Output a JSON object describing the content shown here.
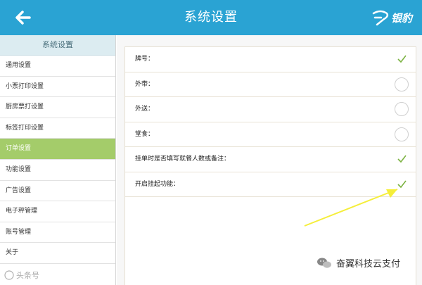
{
  "header": {
    "title": "系统设置",
    "brand": "银豹",
    "color": "#2aa3d3"
  },
  "sidebar": {
    "title": "系统设置",
    "items": [
      {
        "label": "通用设置",
        "active": false
      },
      {
        "label": "小票打印设置",
        "active": false
      },
      {
        "label": "厨房票打设置",
        "active": false
      },
      {
        "label": "标签打印设置",
        "active": false
      },
      {
        "label": "订单设置",
        "active": true
      },
      {
        "label": "功能设置",
        "active": false
      },
      {
        "label": "广告设置",
        "active": false
      },
      {
        "label": "电子秤管理",
        "active": false
      },
      {
        "label": "账号管理",
        "active": false
      },
      {
        "label": "关于",
        "active": false
      }
    ],
    "active_color": "#a4cc6a"
  },
  "settings": [
    {
      "label": "牌号：",
      "checked": true
    },
    {
      "label": "外带：",
      "checked": false
    },
    {
      "label": "外送：",
      "checked": false
    },
    {
      "label": "堂食：",
      "checked": false
    },
    {
      "label": "挂单时是否填写就餐人数或备注：",
      "checked": true
    },
    {
      "label": "开启挂起功能：",
      "checked": true
    }
  ],
  "watermarks": {
    "left": "头条号",
    "right": "奋翼科技云支付"
  },
  "icons": {
    "back": "arrow-left-icon",
    "check": "checkmark-icon",
    "unchecked": "empty-circle-icon",
    "wechat": "wechat-icon"
  }
}
